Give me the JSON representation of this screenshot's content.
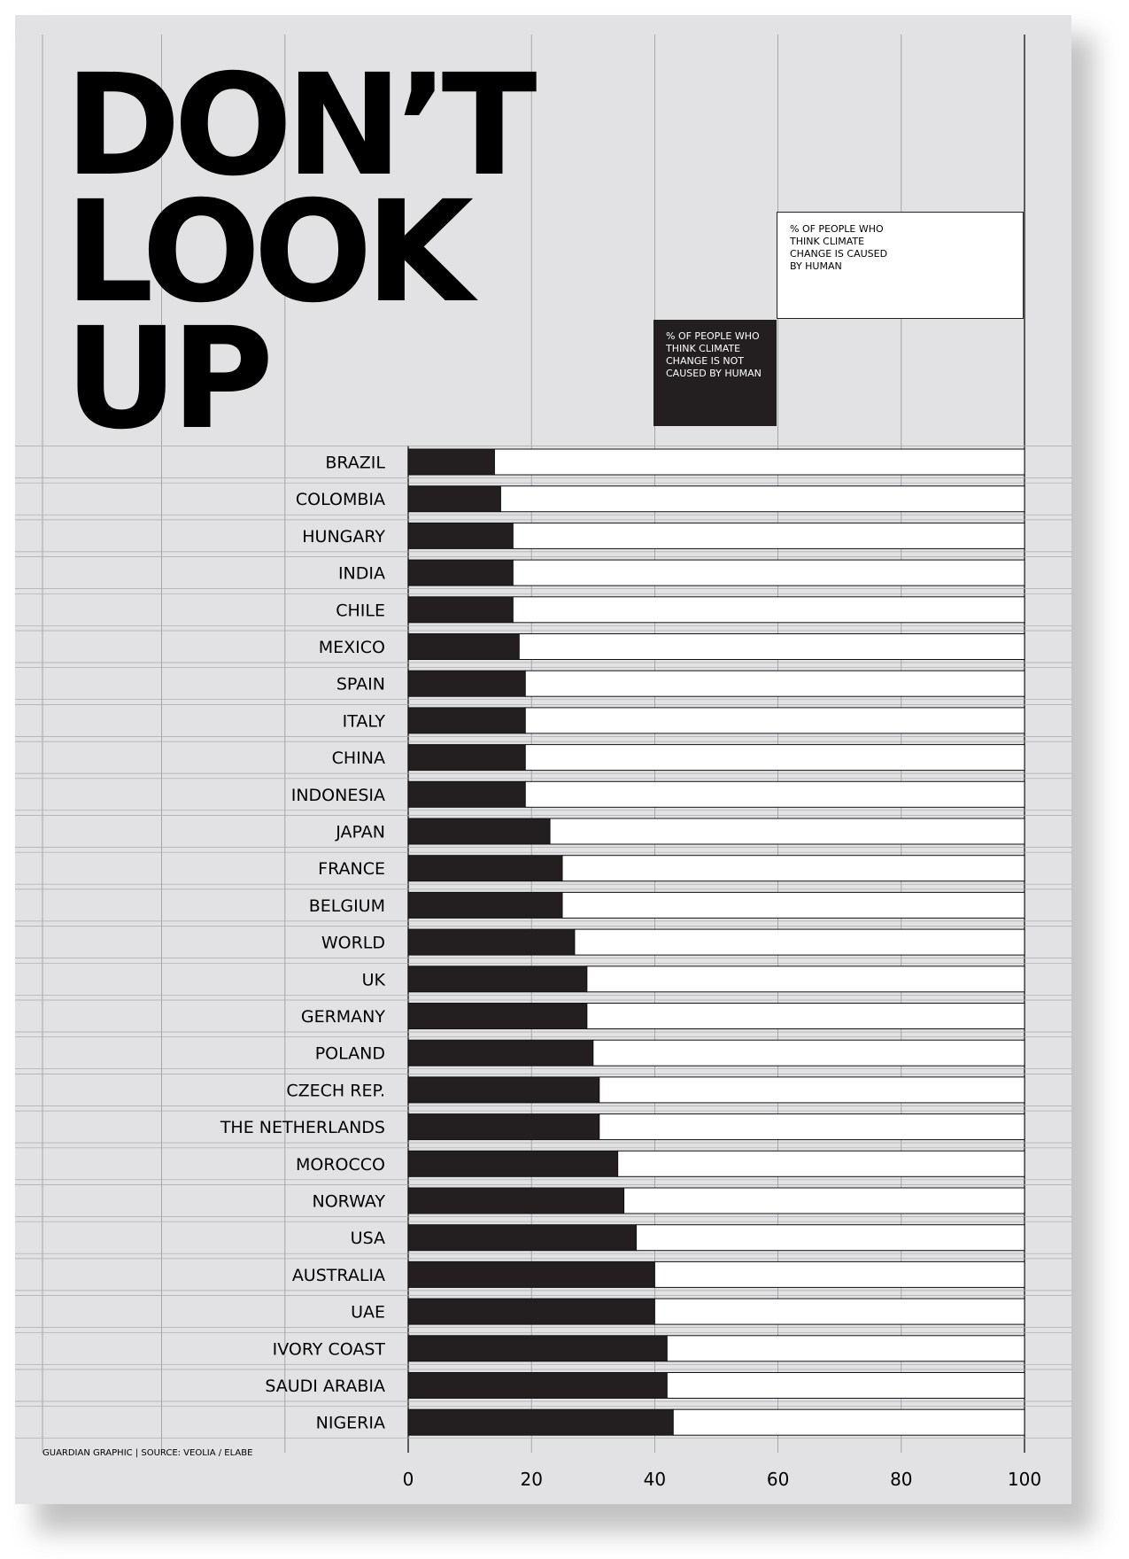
{
  "title_lines": [
    "DON’T",
    "LOOK",
    "UP"
  ],
  "legend": {
    "human_label": "% OF PEOPLE WHO THINK CLIMATE CHANGE IS CAUSED BY HUMAN",
    "not_human_label": "% OF PEOPLE WHO THINK CLIMATE CHANGE IS NOT CAUSED BY HUMAN"
  },
  "source": "GUARDIAN GRAPHIC | SOURCE: VEOLIA / ELABE",
  "colors": {
    "not_human": "#231f20",
    "human": "#ffffff",
    "background": "#e2e2e4"
  },
  "chart_data": {
    "type": "bar",
    "orientation": "horizontal",
    "stacked": true,
    "categories": [
      "BRAZIL",
      "COLOMBIA",
      "HUNGARY",
      "INDIA",
      "CHILE",
      "MEXICO",
      "SPAIN",
      "ITALY",
      "CHINA",
      "INDONESIA",
      "JAPAN",
      "FRANCE",
      "BELGIUM",
      "WORLD",
      "UK",
      "GERMANY",
      "POLAND",
      "CZECH REP.",
      "THE NETHERLANDS",
      "MOROCCO",
      "NORWAY",
      "USA",
      "AUSTRALIA",
      "UAE",
      "IVORY COAST",
      "SAUDI ARABIA",
      "NIGERIA"
    ],
    "series": [
      {
        "name": "% OF PEOPLE WHO THINK CLIMATE CHANGE IS NOT CAUSED BY HUMAN",
        "values": [
          14,
          15,
          17,
          17,
          17,
          18,
          19,
          19,
          19,
          19,
          23,
          25,
          25,
          27,
          29,
          29,
          30,
          31,
          31,
          34,
          35,
          37,
          40,
          40,
          42,
          42,
          43
        ]
      },
      {
        "name": "% OF PEOPLE WHO THINK CLIMATE CHANGE IS CAUSED BY HUMAN",
        "values": [
          86,
          85,
          83,
          83,
          83,
          82,
          81,
          81,
          81,
          81,
          77,
          75,
          75,
          73,
          71,
          71,
          70,
          69,
          69,
          66,
          65,
          63,
          60,
          60,
          58,
          58,
          57
        ]
      }
    ],
    "xlim": [
      0,
      100
    ],
    "xticks": [
      "0",
      "20",
      "40",
      "60",
      "80",
      "100"
    ],
    "grid": true,
    "legend_placement": "top-right"
  }
}
